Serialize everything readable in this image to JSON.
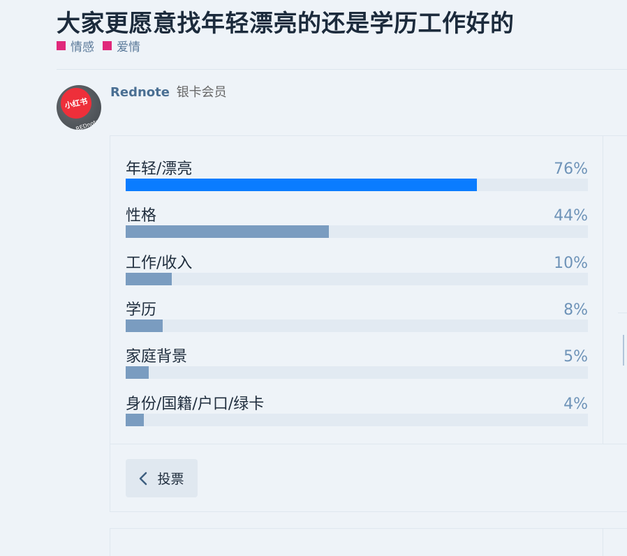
{
  "topic": {
    "title": "大家更愿意找年轻漂亮的还是学历工作好的",
    "tags": [
      {
        "label": "情感",
        "color": "#e0287a"
      },
      {
        "label": "爱情",
        "color": "#e0287a"
      }
    ]
  },
  "post": {
    "username": "Rednote",
    "user_badge": "银卡会员",
    "avatar_text": "小红书",
    "avatar_subtext": "REDnote"
  },
  "poll": {
    "options": [
      {
        "label": "年轻/漂亮",
        "percent_text": "76%",
        "percent": 76
      },
      {
        "label": "性格",
        "percent_text": "44%",
        "percent": 44
      },
      {
        "label": "工作/收入",
        "percent_text": "10%",
        "percent": 10
      },
      {
        "label": "学历",
        "percent_text": "8%",
        "percent": 8
      },
      {
        "label": "家庭背景",
        "percent_text": "5%",
        "percent": 5
      },
      {
        "label": "身份/国籍/户口/绿卡",
        "percent_text": "4%",
        "percent": 4
      }
    ],
    "vote_button_label": "投票"
  }
}
